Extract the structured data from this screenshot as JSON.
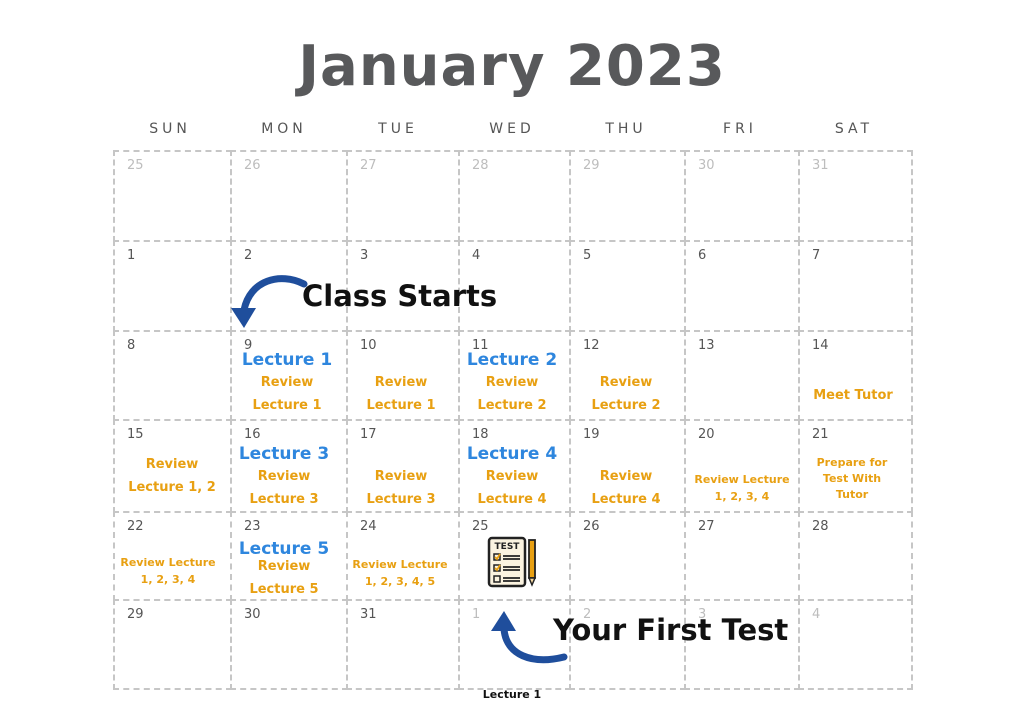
{
  "title": "January 2023",
  "weekdays": [
    "SUN",
    "MON",
    "TUE",
    "WED",
    "THU",
    "FRI",
    "SAT"
  ],
  "days": [
    [
      "25",
      "26",
      "27",
      "28",
      "29",
      "30",
      "31"
    ],
    [
      "1",
      "2",
      "3",
      "4",
      "5",
      "6",
      "7"
    ],
    [
      "8",
      "9",
      "10",
      "11",
      "12",
      "13",
      "14"
    ],
    [
      "15",
      "16",
      "17",
      "18",
      "19",
      "20",
      "21"
    ],
    [
      "22",
      "23",
      "24",
      "25",
      "26",
      "27",
      "28"
    ],
    [
      "29",
      "30",
      "31",
      "1",
      "2",
      "3",
      "4"
    ]
  ],
  "events": {
    "jan9": {
      "lecture": "Lecture 1",
      "review": "Review",
      "review_sub": "Lecture 1"
    },
    "jan10": {
      "review": "Review",
      "review_sub": "Lecture 1"
    },
    "jan11": {
      "lecture": "Lecture 2",
      "review": "Review",
      "review_sub": "Lecture 2"
    },
    "jan12": {
      "review": "Review",
      "review_sub": "Lecture 2"
    },
    "jan14": {
      "text": "Meet Tutor"
    },
    "jan15": {
      "review": "Review",
      "review_sub": "Lecture 1, 2"
    },
    "jan16": {
      "lecture": "Lecture 3",
      "review": "Review",
      "review_sub": "Lecture 3"
    },
    "jan17": {
      "review": "Review",
      "review_sub": "Lecture 3"
    },
    "jan18": {
      "lecture": "Lecture 4",
      "review": "Review",
      "review_sub": "Lecture 4"
    },
    "jan19": {
      "review": "Review",
      "review_sub": "Lecture 4"
    },
    "jan20": {
      "line1": "Review Lecture",
      "line2": "1, 2, 3, 4"
    },
    "jan21": {
      "line1": "Prepare for",
      "line2": "Test With",
      "line3": "Tutor"
    },
    "jan22": {
      "line1": "Review Lecture",
      "line2": "1, 2, 3, 4"
    },
    "jan23": {
      "lecture": "Lecture 5",
      "review": "Review",
      "review_sub": "Lecture 5"
    },
    "jan24": {
      "line1": "Review Lecture",
      "line2": "1, 2, 3, 4, 5"
    },
    "jan25": {
      "icon": "test-clipboard-icon",
      "icon_label": "TEST"
    }
  },
  "callouts": {
    "class_starts": "Class Starts",
    "first_test": "Your First Test"
  },
  "footer": "Lecture 1",
  "colors": {
    "title": "#58595b",
    "lecture": "#2e86de",
    "review": "#e8a012",
    "grid": "#c6c6c6",
    "arrow": "#1f4e9c"
  }
}
